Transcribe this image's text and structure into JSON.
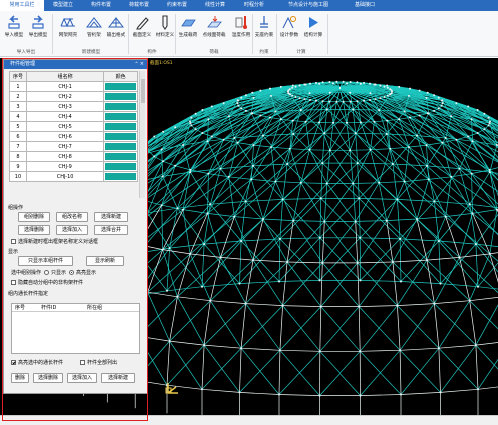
{
  "tabs": [
    "常用工具栏",
    "模型建立",
    "构件布置",
    "荷载布置",
    "约束布置",
    "线性计算",
    "时程分析",
    "节点设计与施工图",
    "基础接口"
  ],
  "active_tab": 0,
  "ribbon": {
    "buttons": [
      "导入模型",
      "导出模型",
      "网架网壳",
      "管桁架",
      "输出格式",
      "截面定义",
      "材料定义",
      "生成载荷",
      "点线面荷载",
      "温度作用",
      "支座约束",
      "设计参数",
      "结构计算"
    ],
    "groups": [
      "导入导出",
      "新建模型",
      "构件",
      "荷载",
      "约束",
      "计算"
    ]
  },
  "canvas": {
    "label": "截面1:OS1"
  },
  "panel": {
    "title": "杆件组管理",
    "columns": [
      "序号",
      "组名称",
      "颜色"
    ],
    "rows": [
      {
        "no": "1",
        "name": "CHJ-1"
      },
      {
        "no": "2",
        "name": "CHJ-2"
      },
      {
        "no": "3",
        "name": "CHJ-3"
      },
      {
        "no": "4",
        "name": "CHJ-4"
      },
      {
        "no": "5",
        "name": "CHJ-5"
      },
      {
        "no": "6",
        "name": "CHJ-6"
      },
      {
        "no": "7",
        "name": "CHJ-7"
      },
      {
        "no": "8",
        "name": "CHJ-8"
      },
      {
        "no": "9",
        "name": "CHJ-9"
      },
      {
        "no": "10",
        "name": "CHJ-10"
      }
    ],
    "swatch_color": "#14a89c",
    "ops_label": "组操作",
    "btn_del_group": "组别删除",
    "btn_rename": "组改名称",
    "btn_new": "选择新建",
    "btn_sel_del": "选择删除",
    "btn_sel_add": "选择加入",
    "btn_merge": "选择合并",
    "chk_auto_define": "选择新建时框出框架名称定义对话框",
    "display_label": "显示",
    "btn_show_current": "只显示本组杆件",
    "btn_show_refresh": "显示刷新",
    "mode_label": "选中组别操作",
    "radio_only": "只显示",
    "radio_highlight": "高亮显示",
    "chk_hide_other": "隐藏自动分组中的非构架杆件",
    "member_list_label": "组内通长杆件指定",
    "list_columns": [
      "序号",
      "杆件ID",
      "所在组"
    ],
    "chk_highlight_select": "高亮选中的通长杆件",
    "chk_all_out": "杆件全部列出",
    "btn_delete": "删除",
    "btn_sel_delete": "选择删除",
    "btn_sel_join": "选择加入",
    "btn_sel_new": "选择新建"
  },
  "colors": {
    "accent": "#2b6bbd",
    "structure": "#1ec8c0",
    "highlight": "#e02020"
  }
}
